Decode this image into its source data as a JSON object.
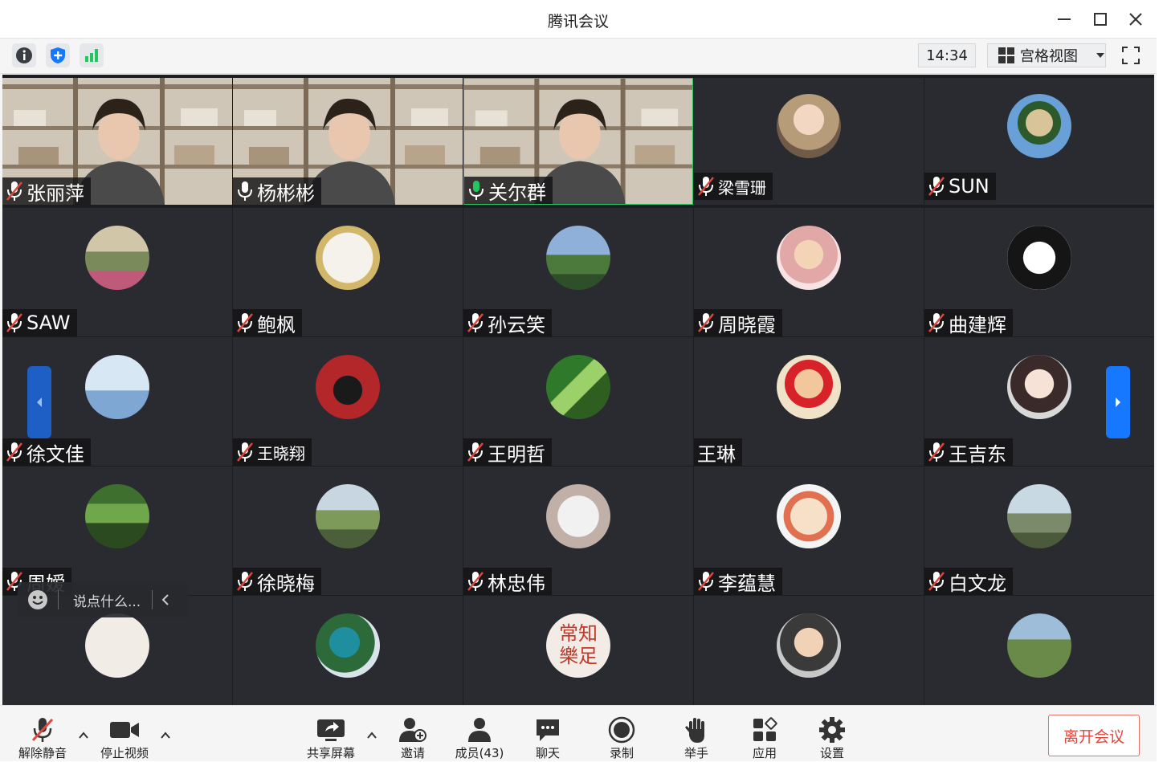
{
  "window": {
    "title": "腾讯会议",
    "controls": {
      "minimize": "—",
      "maximize": "☐",
      "close": "✕"
    }
  },
  "toolbar": {
    "time": "14:34",
    "view_mode": "宫格视图",
    "icons": [
      "info-icon",
      "shield-icon",
      "signal-icon",
      "fullscreen-icon"
    ]
  },
  "colors": {
    "accent_blue": "#1677ff",
    "mic_green": "#22c55e",
    "mic_muted_red": "#e0463e",
    "leave_red": "#e0463e",
    "tile_bg": "#2a2b30",
    "grid_bg": "#1c1d21"
  },
  "participants": [
    {
      "name": "张丽萍",
      "mic": "muted",
      "video": true
    },
    {
      "name": "杨彬彬",
      "mic": "on",
      "video": true
    },
    {
      "name": "关尔群",
      "mic": "speaking",
      "video": true
    },
    {
      "name": "梁雪珊",
      "mic": "muted",
      "video": false
    },
    {
      "name": "SUN",
      "mic": "muted",
      "video": false
    },
    {
      "name": "SAW",
      "mic": "muted",
      "video": false
    },
    {
      "name": "鲍枫",
      "mic": "muted",
      "video": false
    },
    {
      "name": "孙云笑",
      "mic": "muted",
      "video": false
    },
    {
      "name": "周晓霞",
      "mic": "muted",
      "video": false
    },
    {
      "name": "曲建辉",
      "mic": "muted",
      "video": false
    },
    {
      "name": "徐文佳",
      "mic": "muted",
      "video": false
    },
    {
      "name": "王晓翔",
      "mic": "muted",
      "video": false
    },
    {
      "name": "王明哲",
      "mic": "muted",
      "video": false
    },
    {
      "name": "王琳",
      "mic": "none",
      "video": false
    },
    {
      "name": "王吉东",
      "mic": "muted",
      "video": false
    },
    {
      "name": "周嫒",
      "mic": "muted",
      "video": false
    },
    {
      "name": "徐晓梅",
      "mic": "muted",
      "video": false
    },
    {
      "name": "林忠伟",
      "mic": "muted",
      "video": false
    },
    {
      "name": "李蕴慧",
      "mic": "muted",
      "video": false
    },
    {
      "name": "白文龙",
      "mic": "muted",
      "video": false
    },
    {
      "name": "",
      "mic": "none",
      "video": false
    },
    {
      "name": "",
      "mic": "none",
      "video": false
    },
    {
      "name": "",
      "mic": "none",
      "video": false
    },
    {
      "name": "",
      "mic": "none",
      "video": false
    },
    {
      "name": "",
      "mic": "none",
      "video": false
    }
  ],
  "chat": {
    "placeholder": "说点什么..."
  },
  "avatar_text": {
    "top": "常知",
    "bottom": "樂足"
  },
  "bottom_bar": {
    "unmute": "解除静音",
    "stop_video": "停止视频",
    "share_screen": "共享屏幕",
    "invite": "邀请",
    "members": "成员(43)",
    "chat": "聊天",
    "record": "录制",
    "raise_hand": "举手",
    "apps": "应用",
    "settings": "设置",
    "leave": "离开会议"
  }
}
